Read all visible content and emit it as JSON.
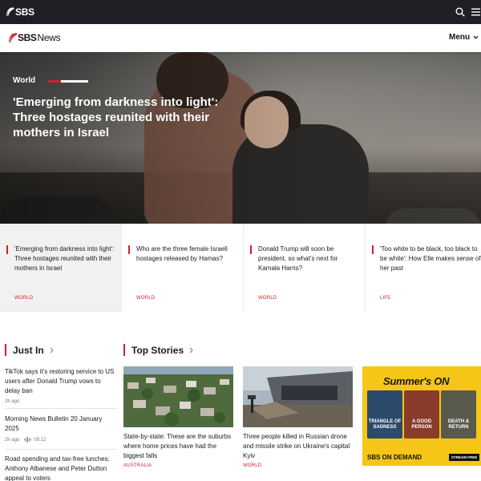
{
  "topbar": {
    "logo": "SBS",
    "search_icon": "search-icon",
    "menu_icon": "hamburger-icon"
  },
  "newsbar": {
    "brand_strong": "SBS",
    "brand_light": "News",
    "menu_label": "Menu"
  },
  "hero": {
    "category": "World",
    "headline": "'Emerging from darkness into light': Three hostages reunited with their mothers in Israel"
  },
  "strip": [
    {
      "title": "'Emerging from darkness into light': Three hostages reunited with their mothers in Israel",
      "tag": "WORLD"
    },
    {
      "title": "Who are the three female Israeli hostages released by Hamas?",
      "tag": "WORLD"
    },
    {
      "title": "Donald Trump will soon be president, so what's next for Kamala Harris?",
      "tag": "WORLD"
    },
    {
      "title": "'Too white to be black, too black to be white': How Elle makes sense of her past",
      "tag": "LIFE"
    }
  ],
  "just_in": {
    "title": "Just In",
    "items": [
      {
        "headline": "TikTok says it's restoring service to US users after Donald Trump vows to delay ban",
        "time": "2h ago",
        "duration": ""
      },
      {
        "headline": "Morning News Bulletin 20 January 2025",
        "time": "2h ago",
        "duration": "05:12"
      },
      {
        "headline": "Road spending and tax-free lunches: Anthony Albanese and Peter Dutton appeal to voters",
        "time": "",
        "duration": ""
      }
    ]
  },
  "top_stories": {
    "title": "Top Stories",
    "items": [
      {
        "headline": "State-by-state: These are the suburbs where home prices have had the biggest falls",
        "tag": "AUSTRALIA"
      },
      {
        "headline": "Three people killed in Russian drone and missile strike on Ukraine's capital Kyiv",
        "tag": "WORLD"
      }
    ]
  },
  "promo": {
    "title": "Summer's ON",
    "posters": [
      "TRIANGLE OF SADNESS",
      "A GOOD PERSON",
      "DEATH & RETURN"
    ],
    "ondemand": "SBS ON DEMAND",
    "cta": "STREAM FREE"
  },
  "colors": {
    "accent": "#d1202f",
    "topbar": "#1e2025",
    "promo": "#f5c518"
  }
}
